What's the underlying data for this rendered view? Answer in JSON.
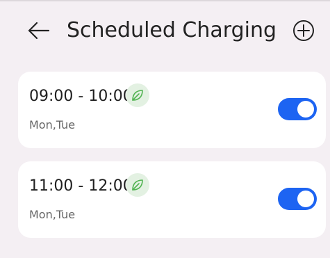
{
  "header": {
    "title": "Scheduled Charging",
    "back_icon": "back-arrow-icon",
    "add_icon": "add-circle-icon"
  },
  "schedules": [
    {
      "time_range": "09:00 - 10:00",
      "days": "Mon,Tue",
      "icon": "leaf-icon",
      "enabled": true
    },
    {
      "time_range": "11:00 - 12:00",
      "days": "Mon,Tue",
      "icon": "leaf-icon",
      "enabled": true
    }
  ],
  "colors": {
    "background": "#f4eff3",
    "card": "#ffffff",
    "accent": "#1d64f2",
    "eco_badge": "#e3f1e2",
    "eco_icon": "#52b452"
  }
}
